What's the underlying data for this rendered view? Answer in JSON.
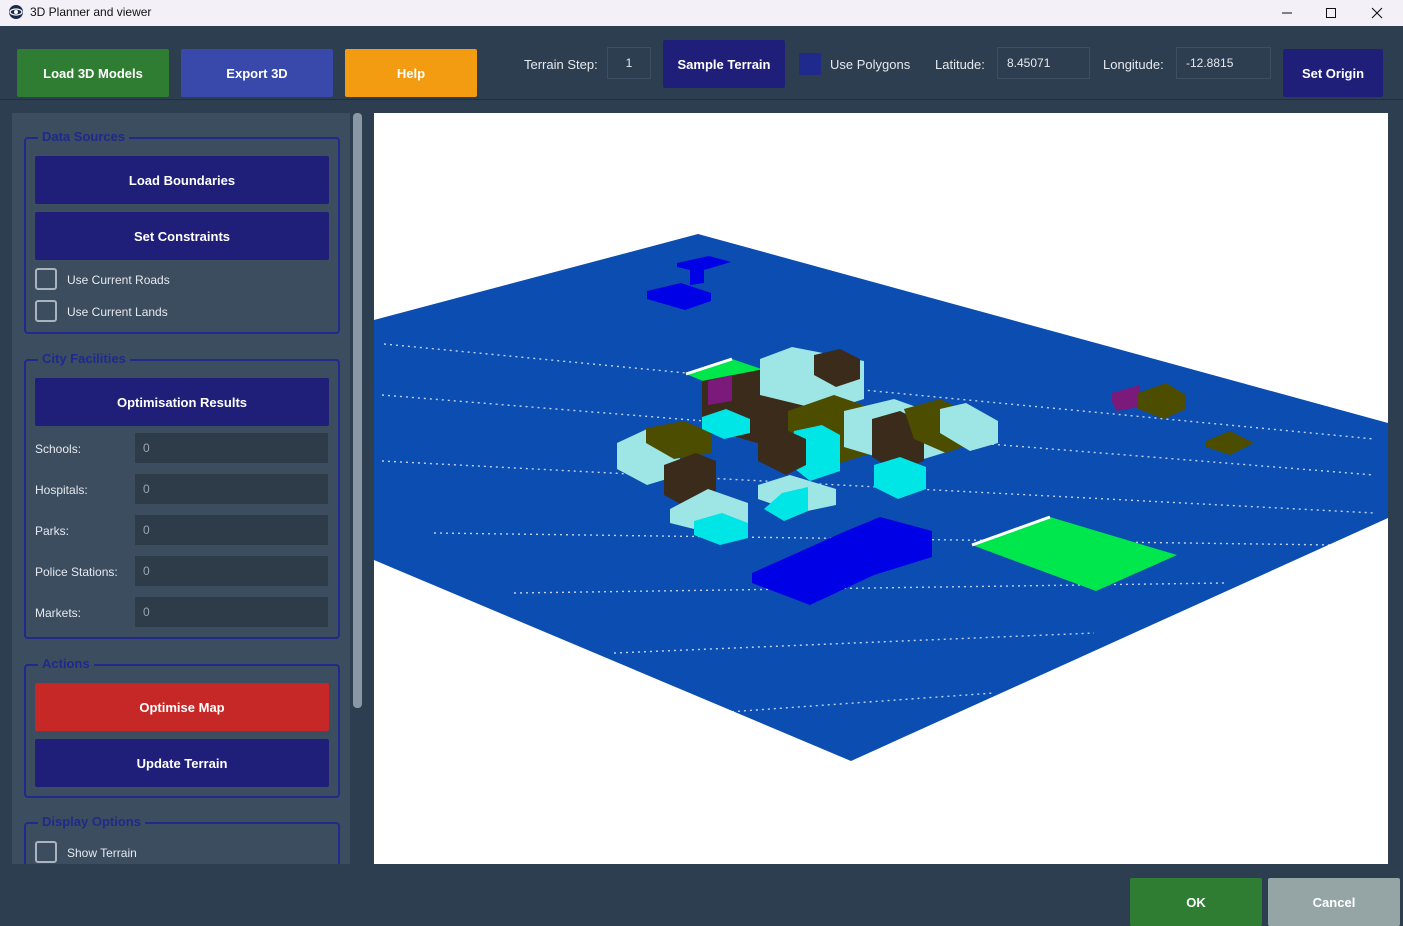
{
  "window": {
    "title": "3D Planner and viewer",
    "minimize_icon": "minimize-icon",
    "maximize_icon": "maximize-icon",
    "close_icon": "close-icon"
  },
  "toolbar": {
    "load_models": "Load 3D Models",
    "export": "Export 3D",
    "help": "Help",
    "terrain_step_label": "Terrain Step:",
    "terrain_step_value": "1",
    "sample_terrain": "Sample Terrain",
    "use_polygons_label": "Use Polygons",
    "latitude_label": "Latitude:",
    "latitude_value": "8.45071",
    "longitude_label": "Longitude:",
    "longitude_value": "-12.8815",
    "set_origin": "Set Origin"
  },
  "sidebar": {
    "data_sources": {
      "title": "Data Sources",
      "load_boundaries": "Load Boundaries",
      "set_constraints": "Set Constraints",
      "use_current_roads": "Use Current Roads",
      "use_current_lands": "Use Current Lands"
    },
    "city_facilities": {
      "title": "City Facilities",
      "optimisation_results": "Optimisation Results",
      "rows": [
        {
          "label": "Schools:",
          "value": "0"
        },
        {
          "label": "Hospitals:",
          "value": "0"
        },
        {
          "label": "Parks:",
          "value": "0"
        },
        {
          "label": "Police Stations:",
          "value": "0"
        },
        {
          "label": "Markets:",
          "value": "0"
        }
      ]
    },
    "actions": {
      "title": "Actions",
      "optimise_map": "Optimise Map",
      "update_terrain": "Update Terrain"
    },
    "display_options": {
      "title": "Display Options",
      "show_terrain": "Show Terrain"
    }
  },
  "footer": {
    "ok": "OK",
    "cancel": "Cancel"
  },
  "colors": {
    "green": "#2e7d32",
    "indigo": "#3949ab",
    "orange": "#f39c12",
    "navy": "#1f1f7a",
    "red": "#c62828",
    "gray": "#95a5a6",
    "terrain": "#0b4db0"
  }
}
